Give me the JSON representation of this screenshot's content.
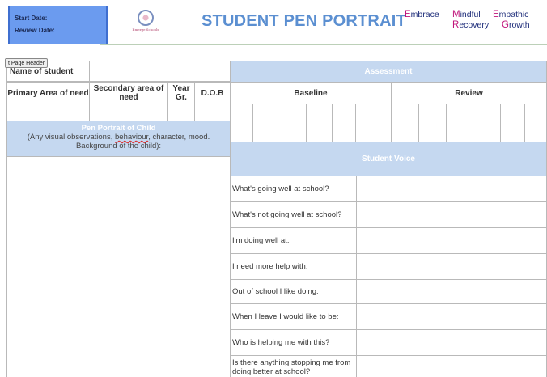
{
  "header": {
    "start_date_label": "Start Date:",
    "review_date_label": "Review Date:",
    "school_name": "Emerge Schools",
    "title": "STUDENT PEN PORTRAIT",
    "values": [
      {
        "initial": "E",
        "rest": "mbrace"
      },
      {
        "initial": "M",
        "rest": "indful"
      },
      {
        "initial": "E",
        "rest": "mpathic"
      },
      {
        "initial": "R",
        "rest": "ecovery"
      },
      {
        "initial": "G",
        "rest": "rowth"
      }
    ]
  },
  "page_header_tag": "t Page Header",
  "table": {
    "name_label": "Name of student",
    "primary_label": "Primary Area of need",
    "secondary_label": "Secondary area of need",
    "year_label": "Year Gr.",
    "dob_label": "D.O.B",
    "assessment_label": "Assessment",
    "baseline_label": "Baseline",
    "review_label": "Review",
    "pen_portrait_title": "Pen Portrait of Child",
    "pen_portrait_note_pre": "(Any visual observations, ",
    "pen_portrait_note_misspelled": "behaviour",
    "pen_portrait_note_post": ", character, mood. Background of the child):",
    "student_voice_label": "Student Voice",
    "questions": [
      "What's going well at school?",
      "What's not going well at school?",
      "I'm doing well at:",
      "I need more help with:",
      "Out of school I like doing:",
      "When I leave I would like to be:",
      "Who is helping me with this?",
      "Is there anything stopping me from doing better at school?"
    ]
  },
  "colors": {
    "header_box": "#6b9bef",
    "title": "#5b8fd1",
    "section_fill": "#c5d8f0",
    "value_initial": "#c0137a",
    "value_text": "#1e2d7a"
  }
}
